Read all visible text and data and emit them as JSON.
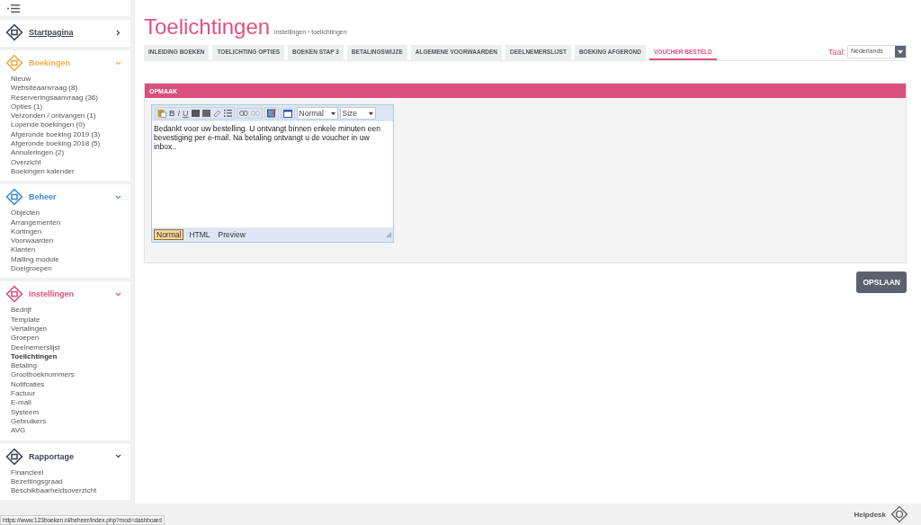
{
  "sidebar": {
    "sections": [
      {
        "title": "Startpagina",
        "color": "#3f4651",
        "expanded": false
      },
      {
        "title": "Boekingen",
        "color": "#f2ae4a",
        "expanded": true,
        "items": [
          {
            "label": "Nieuw",
            "selected": false
          },
          {
            "label": "Websiteaanvraag (8)",
            "selected": false
          },
          {
            "label": "Reserveringsaanvraag (36)",
            "selected": false
          },
          {
            "label": "Opties (1)",
            "selected": false
          },
          {
            "label": "Verzonden / ontvangen (1)",
            "selected": false
          },
          {
            "label": "Lopende boekingen (0)",
            "selected": false
          },
          {
            "label": "Afgeronde boeking 2019 (3)",
            "selected": false
          },
          {
            "label": "Afgeronde boeking 2018 (5)",
            "selected": false
          },
          {
            "label": "Annuleringen (2)",
            "selected": false
          },
          {
            "label": "Overzicht",
            "selected": false
          },
          {
            "label": "Boekingen kalender",
            "selected": false
          }
        ]
      },
      {
        "title": "Beheer",
        "color": "#3d8fd8",
        "expanded": true,
        "items": [
          {
            "label": "Objecten",
            "selected": false
          },
          {
            "label": "Arrangementen",
            "selected": false
          },
          {
            "label": "Kortingen",
            "selected": false
          },
          {
            "label": "Voorwaarden",
            "selected": false
          },
          {
            "label": "Klanten",
            "selected": false
          },
          {
            "label": "Mailing module",
            "selected": false
          },
          {
            "label": "Doelgroepen",
            "selected": false
          }
        ]
      },
      {
        "title": "Instellingen",
        "color": "#e0517f",
        "expanded": true,
        "items": [
          {
            "label": "Bedrijf",
            "selected": false
          },
          {
            "label": "Template",
            "selected": false
          },
          {
            "label": "Vertalingen",
            "selected": false
          },
          {
            "label": "Groepen",
            "selected": false
          },
          {
            "label": "Deelnemerslijst",
            "selected": false
          },
          {
            "label": "Toelichtingen",
            "selected": true
          },
          {
            "label": "Betaling",
            "selected": false
          },
          {
            "label": "Grootboeknummers",
            "selected": false
          },
          {
            "label": "Notifcaties",
            "selected": false
          },
          {
            "label": "Factuur",
            "selected": false
          },
          {
            "label": "E-mail",
            "selected": false
          },
          {
            "label": "Systeem",
            "selected": false
          },
          {
            "label": "Gebruikers",
            "selected": false
          },
          {
            "label": "AVG",
            "selected": false
          }
        ]
      },
      {
        "title": "Rapportage",
        "color": "#3f4651",
        "expanded": true,
        "items": [
          {
            "label": "Financieel",
            "selected": false
          },
          {
            "label": "Bezettingsgraad",
            "selected": false
          },
          {
            "label": "Beschikbaarheidsoverzicht",
            "selected": false
          }
        ]
      }
    ]
  },
  "page": {
    "title": "Toelichtingen",
    "breadcrumb": "instellingen › toelichtingen"
  },
  "tabs": [
    {
      "label": "INLEIDING BOEKEN",
      "selected": false
    },
    {
      "label": "TOELICHTING OPTIES",
      "selected": false
    },
    {
      "label": "BOEKEN STAP 3",
      "selected": false
    },
    {
      "label": "BETALINGSWIJZE",
      "selected": false
    },
    {
      "label": "ALGEMENE VOORWAARDEN",
      "selected": false
    },
    {
      "label": "DEELNEMERSLIJST",
      "selected": false
    },
    {
      "label": "BOEKING AFGEROND",
      "selected": false
    },
    {
      "label": "VOUCHER BESTELD",
      "selected": true
    }
  ],
  "language": {
    "label": "Taal:",
    "value": "Nederlands"
  },
  "panel": {
    "title": "OPMAAK",
    "editor": {
      "bold": "B",
      "italic": "I",
      "underline": "U",
      "format": "Normal",
      "size": "Size",
      "content": "Bedankt voor uw bestelling. U ontvangt binnen enkele minuten een bevestiging per e-mail. Na betaling ontvangt u de voucher in uw inbox..",
      "modes": [
        {
          "label": "Normal",
          "selected": true
        },
        {
          "label": "HTML",
          "selected": false
        },
        {
          "label": "Preview",
          "selected": false
        }
      ]
    }
  },
  "save_button": "OPSLAAN",
  "footer": {
    "helpdesk": "Helpdesk"
  },
  "status_url": "https://www.123boeken.nl/beheer/index.php?mod=dashboard"
}
